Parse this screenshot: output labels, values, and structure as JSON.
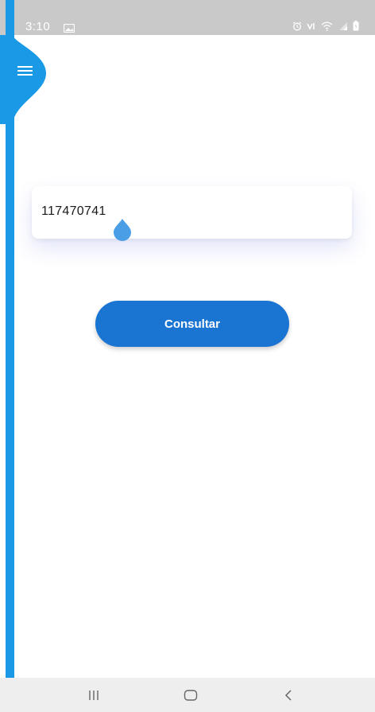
{
  "status_bar": {
    "time": "3:10",
    "left_icons": [
      "image-icon"
    ],
    "right_icons": [
      "alarm-icon",
      "volte-icon",
      "wifi-icon",
      "signal-icon",
      "battery-icon"
    ]
  },
  "drawer": {
    "menu_icon": "hamburger-menu-icon",
    "accent_color": "#1a9ae6"
  },
  "search": {
    "value": "117470741",
    "placeholder": ""
  },
  "actions": {
    "consult_label": "Consultar",
    "button_color": "#1a74d2"
  },
  "nav_bar": {
    "buttons": [
      "recent-apps-icon",
      "home-icon",
      "back-icon"
    ]
  }
}
